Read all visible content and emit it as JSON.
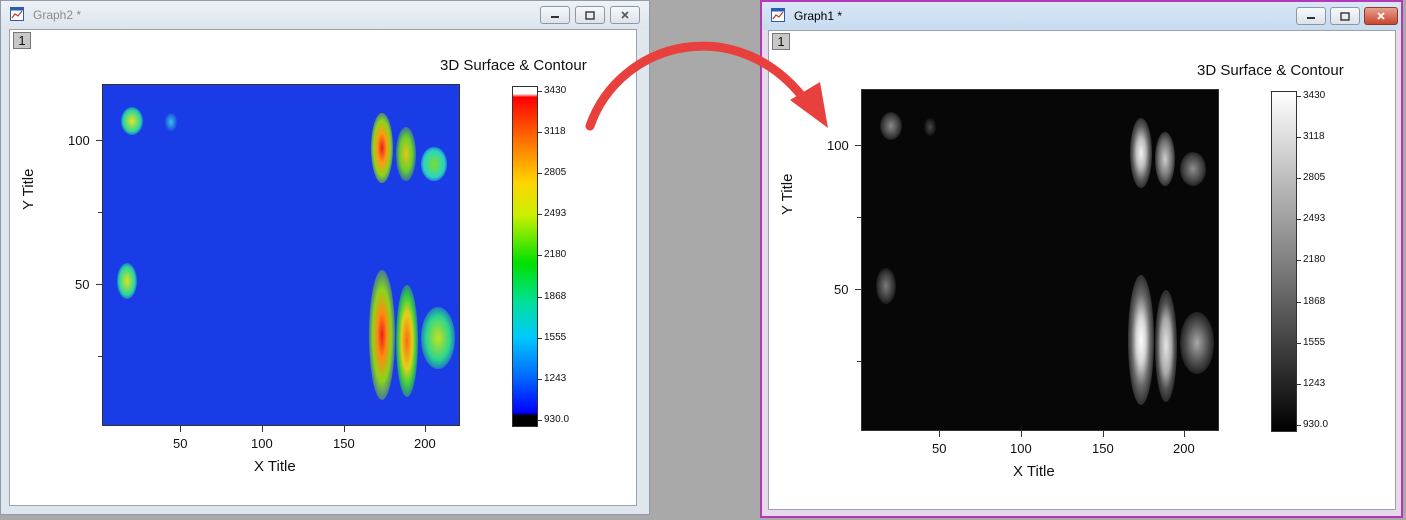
{
  "windows": {
    "left": {
      "title": "Graph2 *",
      "layer_tab": "1"
    },
    "right": {
      "title": "Graph1 *",
      "layer_tab": "1"
    }
  },
  "plot": {
    "title": "3D Surface & Contour",
    "x_title": "X Title",
    "y_title": "Y Title",
    "x_ticks": [
      "50",
      "100",
      "150",
      "200"
    ],
    "y_ticks": [
      "100",
      "50"
    ]
  },
  "colorbar": {
    "labels": [
      "3430",
      "3118",
      "2805",
      "2493",
      "2180",
      "1868",
      "1555",
      "1243",
      "930.0"
    ]
  },
  "colors": {
    "arrow": "#e8403c",
    "active_border": "#b23ab8"
  }
}
